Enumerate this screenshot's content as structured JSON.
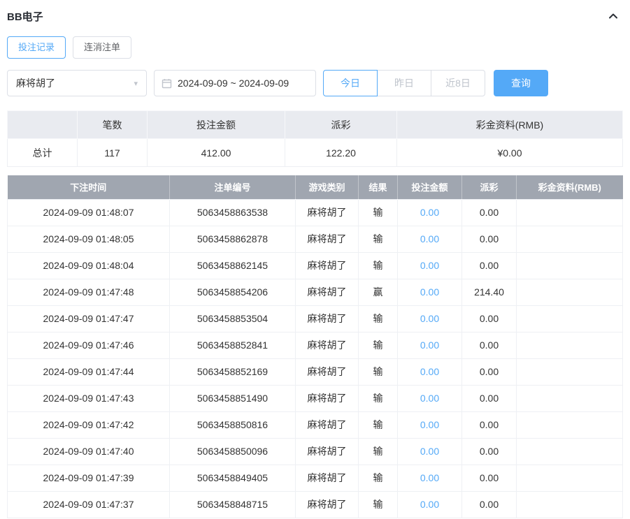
{
  "header": {
    "title": "BB电子",
    "collapse_icon": "chevron-up-icon"
  },
  "tabs": [
    {
      "label": "投注记录",
      "active": true
    },
    {
      "label": "连消注单",
      "active": false
    }
  ],
  "filters": {
    "game_select_value": "麻将胡了",
    "date_range_value": "2024-09-09 ~ 2024-09-09",
    "quick_buttons": [
      {
        "label": "今日",
        "active": true
      },
      {
        "label": "昨日",
        "active": false
      },
      {
        "label": "近8日",
        "active": false
      }
    ],
    "search_label": "查询"
  },
  "summary": {
    "headers": [
      "",
      "笔数",
      "投注金额",
      "派彩",
      "彩金资料(RMB)"
    ],
    "row_label": "总计",
    "count": "117",
    "bet_amount": "412.00",
    "payout": "122.20",
    "bonus": "¥0.00"
  },
  "table": {
    "headers": [
      "下注时间",
      "注单编号",
      "游戏类别",
      "结果",
      "投注金额",
      "派彩",
      "彩金资料(RMB)"
    ],
    "rows": [
      [
        "2024-09-09 01:48:07",
        "5063458863538",
        "麻将胡了",
        "输",
        "0.00",
        "0.00",
        ""
      ],
      [
        "2024-09-09 01:48:05",
        "5063458862878",
        "麻将胡了",
        "输",
        "0.00",
        "0.00",
        ""
      ],
      [
        "2024-09-09 01:48:04",
        "5063458862145",
        "麻将胡了",
        "输",
        "0.00",
        "0.00",
        ""
      ],
      [
        "2024-09-09 01:47:48",
        "5063458854206",
        "麻将胡了",
        "赢",
        "0.00",
        "214.40",
        ""
      ],
      [
        "2024-09-09 01:47:47",
        "5063458853504",
        "麻将胡了",
        "输",
        "0.00",
        "0.00",
        ""
      ],
      [
        "2024-09-09 01:47:46",
        "5063458852841",
        "麻将胡了",
        "输",
        "0.00",
        "0.00",
        ""
      ],
      [
        "2024-09-09 01:47:44",
        "5063458852169",
        "麻将胡了",
        "输",
        "0.00",
        "0.00",
        ""
      ],
      [
        "2024-09-09 01:47:43",
        "5063458851490",
        "麻将胡了",
        "输",
        "0.00",
        "0.00",
        ""
      ],
      [
        "2024-09-09 01:47:42",
        "5063458850816",
        "麻将胡了",
        "输",
        "0.00",
        "0.00",
        ""
      ],
      [
        "2024-09-09 01:47:40",
        "5063458850096",
        "麻将胡了",
        "输",
        "0.00",
        "0.00",
        ""
      ],
      [
        "2024-09-09 01:47:39",
        "5063458849405",
        "麻将胡了",
        "输",
        "0.00",
        "0.00",
        ""
      ],
      [
        "2024-09-09 01:47:37",
        "5063458848715",
        "麻将胡了",
        "输",
        "0.00",
        "0.00",
        ""
      ]
    ]
  },
  "colors": {
    "accent": "#54a9f7",
    "table_header_bg": "#a0a6b0",
    "summary_header_bg": "#e9ebf0",
    "muted_text": "#bfc4cc"
  }
}
